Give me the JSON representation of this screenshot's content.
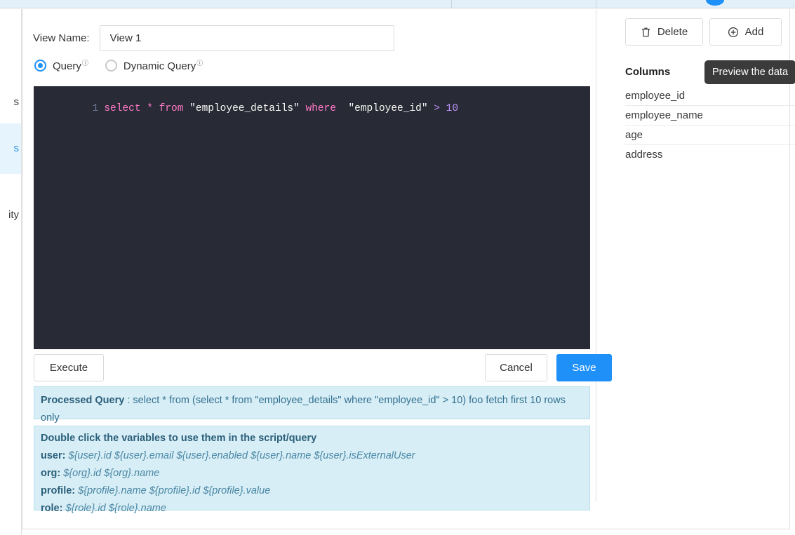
{
  "sidebar": {
    "items": [
      {
        "label": "s",
        "active": false
      },
      {
        "label": "s",
        "active": true
      },
      {
        "label": "ity",
        "active": false
      }
    ]
  },
  "form": {
    "name_label": "View Name:",
    "name_value": "View 1",
    "name_placeholder": "View Name"
  },
  "query_type": {
    "options": [
      {
        "label": "Query",
        "info": "ⓘ",
        "selected": true
      },
      {
        "label": "Dynamic Query",
        "info": "ⓘ",
        "selected": false
      }
    ]
  },
  "editor": {
    "line_number": "1",
    "tokens": [
      {
        "text": "select",
        "type": "kw"
      },
      {
        "text": " ",
        "type": "punc"
      },
      {
        "text": "*",
        "type": "kw"
      },
      {
        "text": " ",
        "type": "punc"
      },
      {
        "text": "from",
        "type": "kw"
      },
      {
        "text": " ",
        "type": "punc"
      },
      {
        "text": "\"employee_details\"",
        "type": "str"
      },
      {
        "text": " ",
        "type": "punc"
      },
      {
        "text": "where",
        "type": "kw"
      },
      {
        "text": "  ",
        "type": "punc"
      },
      {
        "text": "\"employee_id\"",
        "type": "str"
      },
      {
        "text": " ",
        "type": "punc"
      },
      {
        "text": ">",
        "type": "op"
      },
      {
        "text": " ",
        "type": "punc"
      },
      {
        "text": "10",
        "type": "num"
      }
    ],
    "full_text": "select * from \"employee_details\" where  \"employee_id\" > 10"
  },
  "buttons": {
    "execute": "Execute",
    "cancel": "Cancel",
    "save": "Save"
  },
  "processed_query": {
    "label": "Processed Query",
    "separator": " : ",
    "value": "select * from (select * from \"employee_details\" where \"employee_id\" > 10) foo fetch first 10 rows only"
  },
  "variables": {
    "title": "Double click the variables to use them in the script/query",
    "rows": [
      {
        "key": "user:",
        "values": "${user}.id  ${user}.email  ${user}.enabled  ${user}.name  ${user}.isExternalUser"
      },
      {
        "key": "org:",
        "values": "${org}.id  ${org}.name"
      },
      {
        "key": "profile:",
        "values": "${profile}.name  ${profile}.id  ${profile}.value"
      },
      {
        "key": "role:",
        "values": "${role}.id  ${role}.name"
      }
    ]
  },
  "right_panel": {
    "delete_label": "Delete",
    "add_label": "Add",
    "columns_title": "Columns",
    "tooltip": "Preview the data",
    "columns": [
      "employee_id",
      "employee_name",
      "age",
      "address"
    ]
  },
  "colors": {
    "accent": "#1e90f7",
    "editor_bg": "#282a36",
    "info_bg": "#d7eef6",
    "info_text": "#33708f",
    "tooltip_bg": "#3b3b3b",
    "strip_bg": "#e3f0fa"
  }
}
